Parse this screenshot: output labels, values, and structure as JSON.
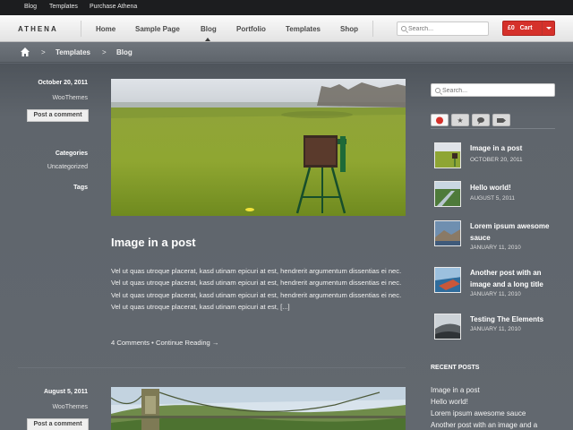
{
  "topbar": {
    "links": [
      "Blog",
      "Templates",
      "Purchase Athena"
    ]
  },
  "nav": {
    "logo": "ATHENA",
    "items": [
      "Home",
      "Sample Page",
      "Blog",
      "Portfolio",
      "Templates",
      "Shop"
    ],
    "active": "Blog",
    "search_placeholder": "Search...",
    "cart_label": "£0   Cart"
  },
  "breadcrumb": {
    "items": [
      "Templates",
      "Blog"
    ]
  },
  "posts": [
    {
      "date": "October 20, 2011",
      "author": "WooThemes",
      "comment_button": "Post a comment",
      "categories_label": "Categories",
      "category": "Uncategorized",
      "tags_label": "Tags",
      "title": "Image in a post",
      "excerpt": "Vel ut quas utroque placerat, kasd utinam epicuri at est, hendrerit argumentum dissentias ei nec. Vel ut quas utroque placerat, kasd utinam epicuri at est, hendrerit argumentum dissentias ei nec. Vel ut quas utroque placerat, kasd utinam epicuri at est, hendrerit argumentum dissentias ei nec. Vel ut quas utroque placerat, kasd utinam epicuri at est, [...]",
      "comments_link": "4 Comments",
      "separator": "•",
      "continue_link": "Continue Reading →"
    },
    {
      "date": "August 5, 2011",
      "author": "WooThemes",
      "comment_button": "Post a comment"
    }
  ],
  "sidebar": {
    "search_placeholder": "Search...",
    "tab_icons": [
      "clock-icon",
      "star-icon",
      "comment-icon",
      "tag-icon"
    ],
    "popular": [
      {
        "title": "Image in a post",
        "date": "OCTOBER 20, 2011"
      },
      {
        "title": "Hello world!",
        "date": "AUGUST 5, 2011"
      },
      {
        "title": "Lorem ipsum awesome sauce",
        "date": "JANUARY 11, 2010"
      },
      {
        "title": "Another post with an image and a long title",
        "date": "JANUARY 11, 2010"
      },
      {
        "title": "Testing The Elements",
        "date": "JANUARY 11, 2010"
      }
    ],
    "recent_heading": "RECENT POSTS",
    "recent": [
      "Image in a post",
      "Hello world!",
      "Lorem ipsum awesome sauce",
      "Another post with an image and a"
    ]
  },
  "colors": {
    "accent": "#d5312b",
    "background": "#5d636b",
    "topbar": "#1c1d1f"
  }
}
